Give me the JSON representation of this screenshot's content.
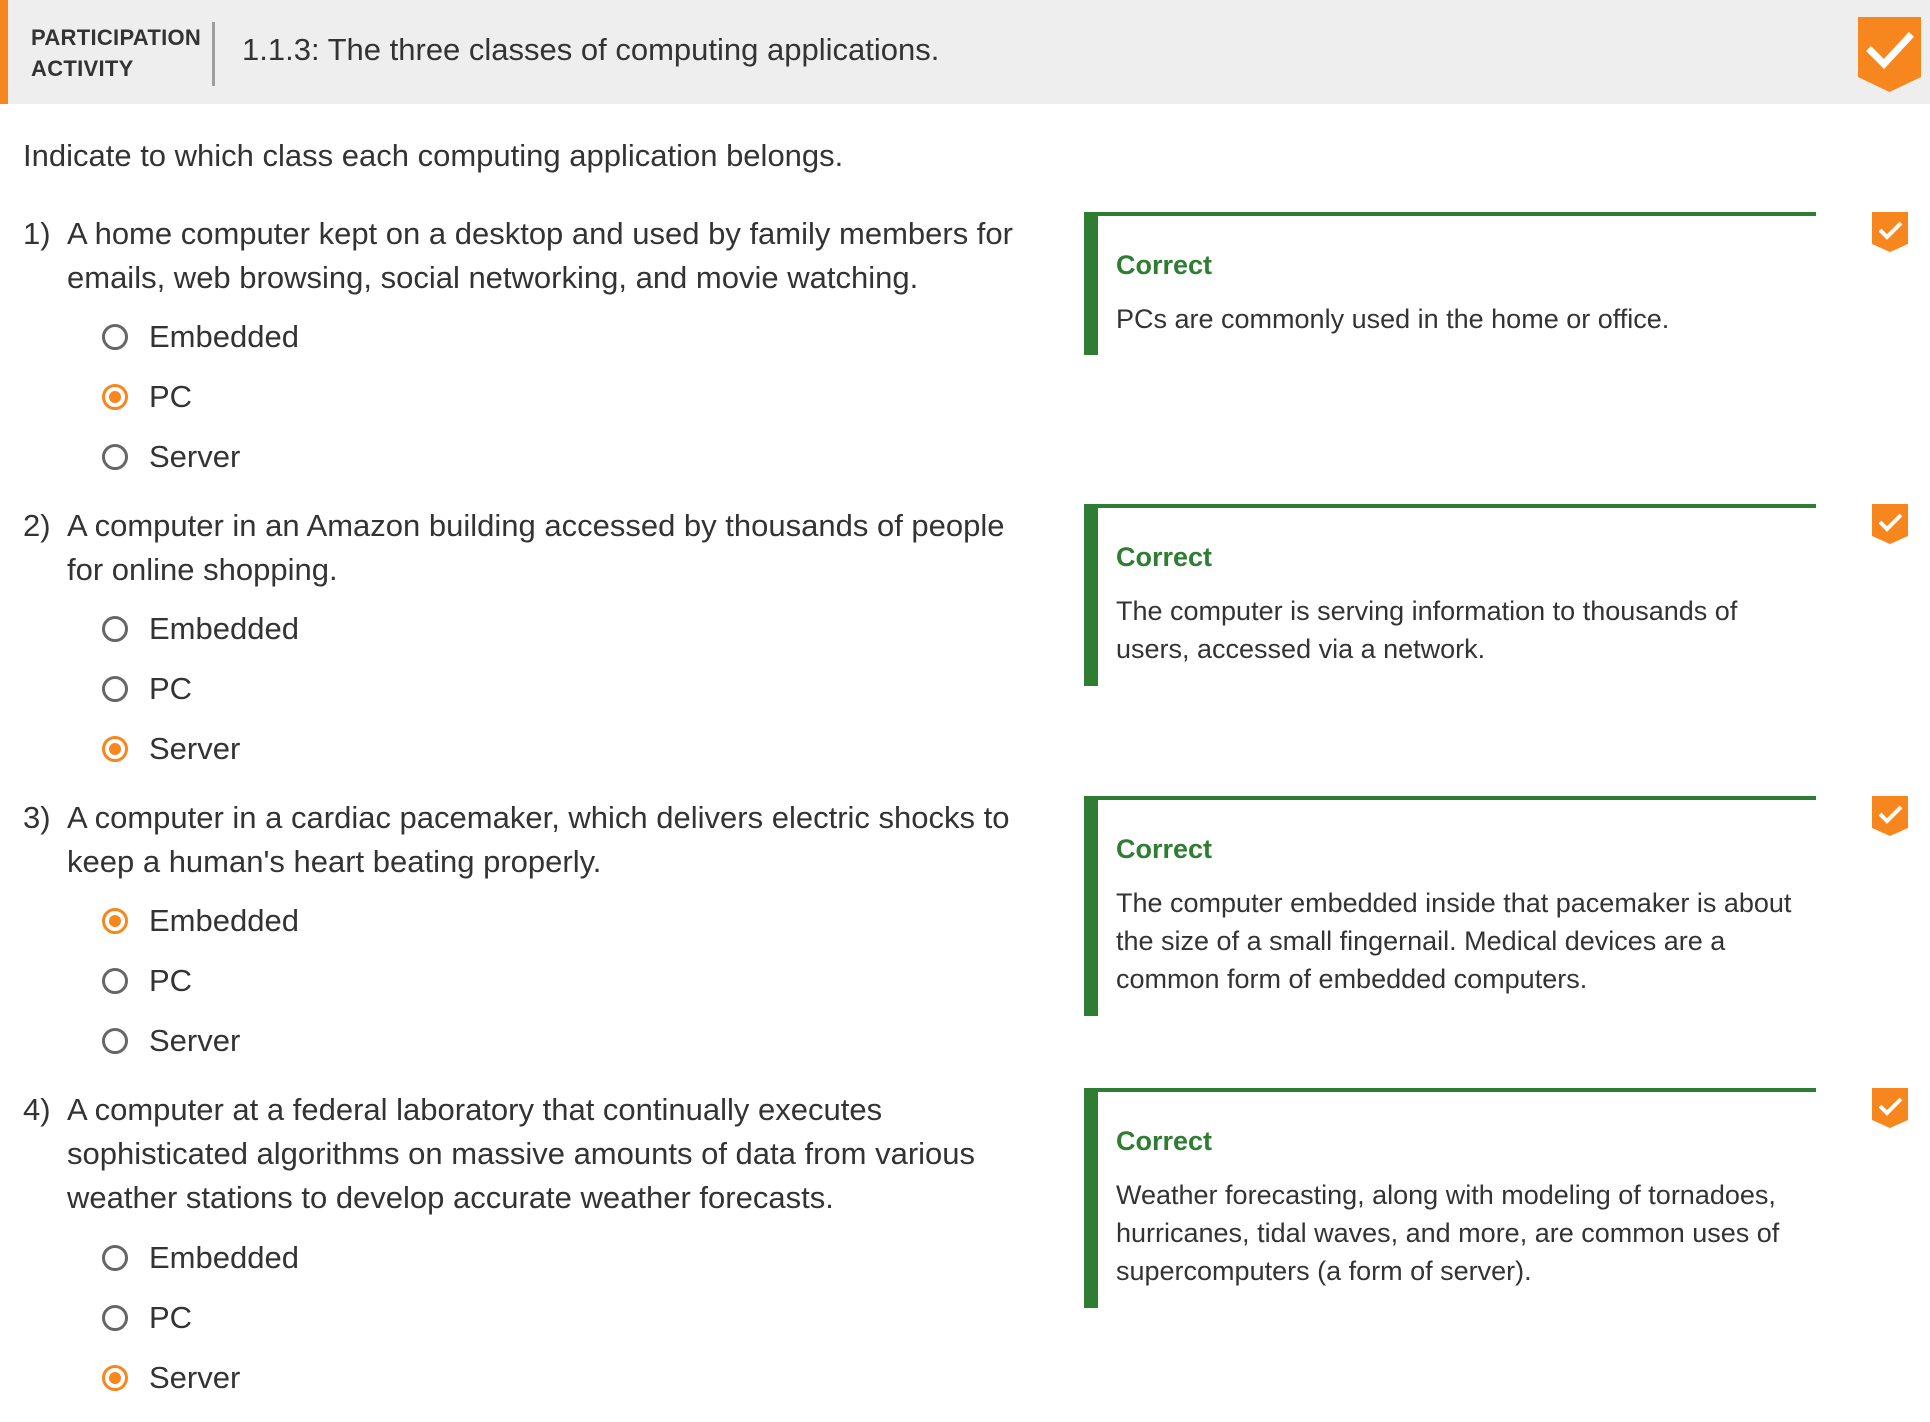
{
  "header": {
    "label_line1": "PARTICIPATION",
    "label_line2": "ACTIVITY",
    "title": "1.1.3: The three classes of computing applications.",
    "badge_icon": "checkmark-badge-icon"
  },
  "instructions": "Indicate to which class each computing application belongs.",
  "colors": {
    "accent": "#f7861f",
    "correct": "#2e7d32",
    "header_bg": "#eeeeee"
  },
  "questions": [
    {
      "number": "1)",
      "text": "A home computer kept on a desktop and used by family members for emails, web browsing, social networking, and movie watching.",
      "options": [
        "Embedded",
        "PC",
        "Server"
      ],
      "selected": "PC",
      "feedback": {
        "title": "Correct",
        "text": "PCs are commonly used in the home or office."
      }
    },
    {
      "number": "2)",
      "text": "A computer in an Amazon building accessed by thousands of people for online shopping.",
      "options": [
        "Embedded",
        "PC",
        "Server"
      ],
      "selected": "Server",
      "feedback": {
        "title": "Correct",
        "text": "The computer is serving information to thousands of users, accessed via a network."
      }
    },
    {
      "number": "3)",
      "text": "A computer in a cardiac pacemaker, which delivers electric shocks to keep a human's heart beating properly.",
      "options": [
        "Embedded",
        "PC",
        "Server"
      ],
      "selected": "Embedded",
      "feedback": {
        "title": "Correct",
        "text": "The computer embedded inside that pacemaker is about the size of a small fingernail. Medical devices are a common form of embedded computers."
      }
    },
    {
      "number": "4)",
      "text": "A computer at a federal laboratory that continually executes sophisticated algorithms on massive amounts of data from various weather stations to develop accurate weather forecasts.",
      "options": [
        "Embedded",
        "PC",
        "Server"
      ],
      "selected": "Server",
      "feedback": {
        "title": "Correct",
        "text": "Weather forecasting, along with modeling of tornadoes, hurricanes, tidal waves, and more, are common uses of supercomputers (a form of server)."
      }
    }
  ]
}
